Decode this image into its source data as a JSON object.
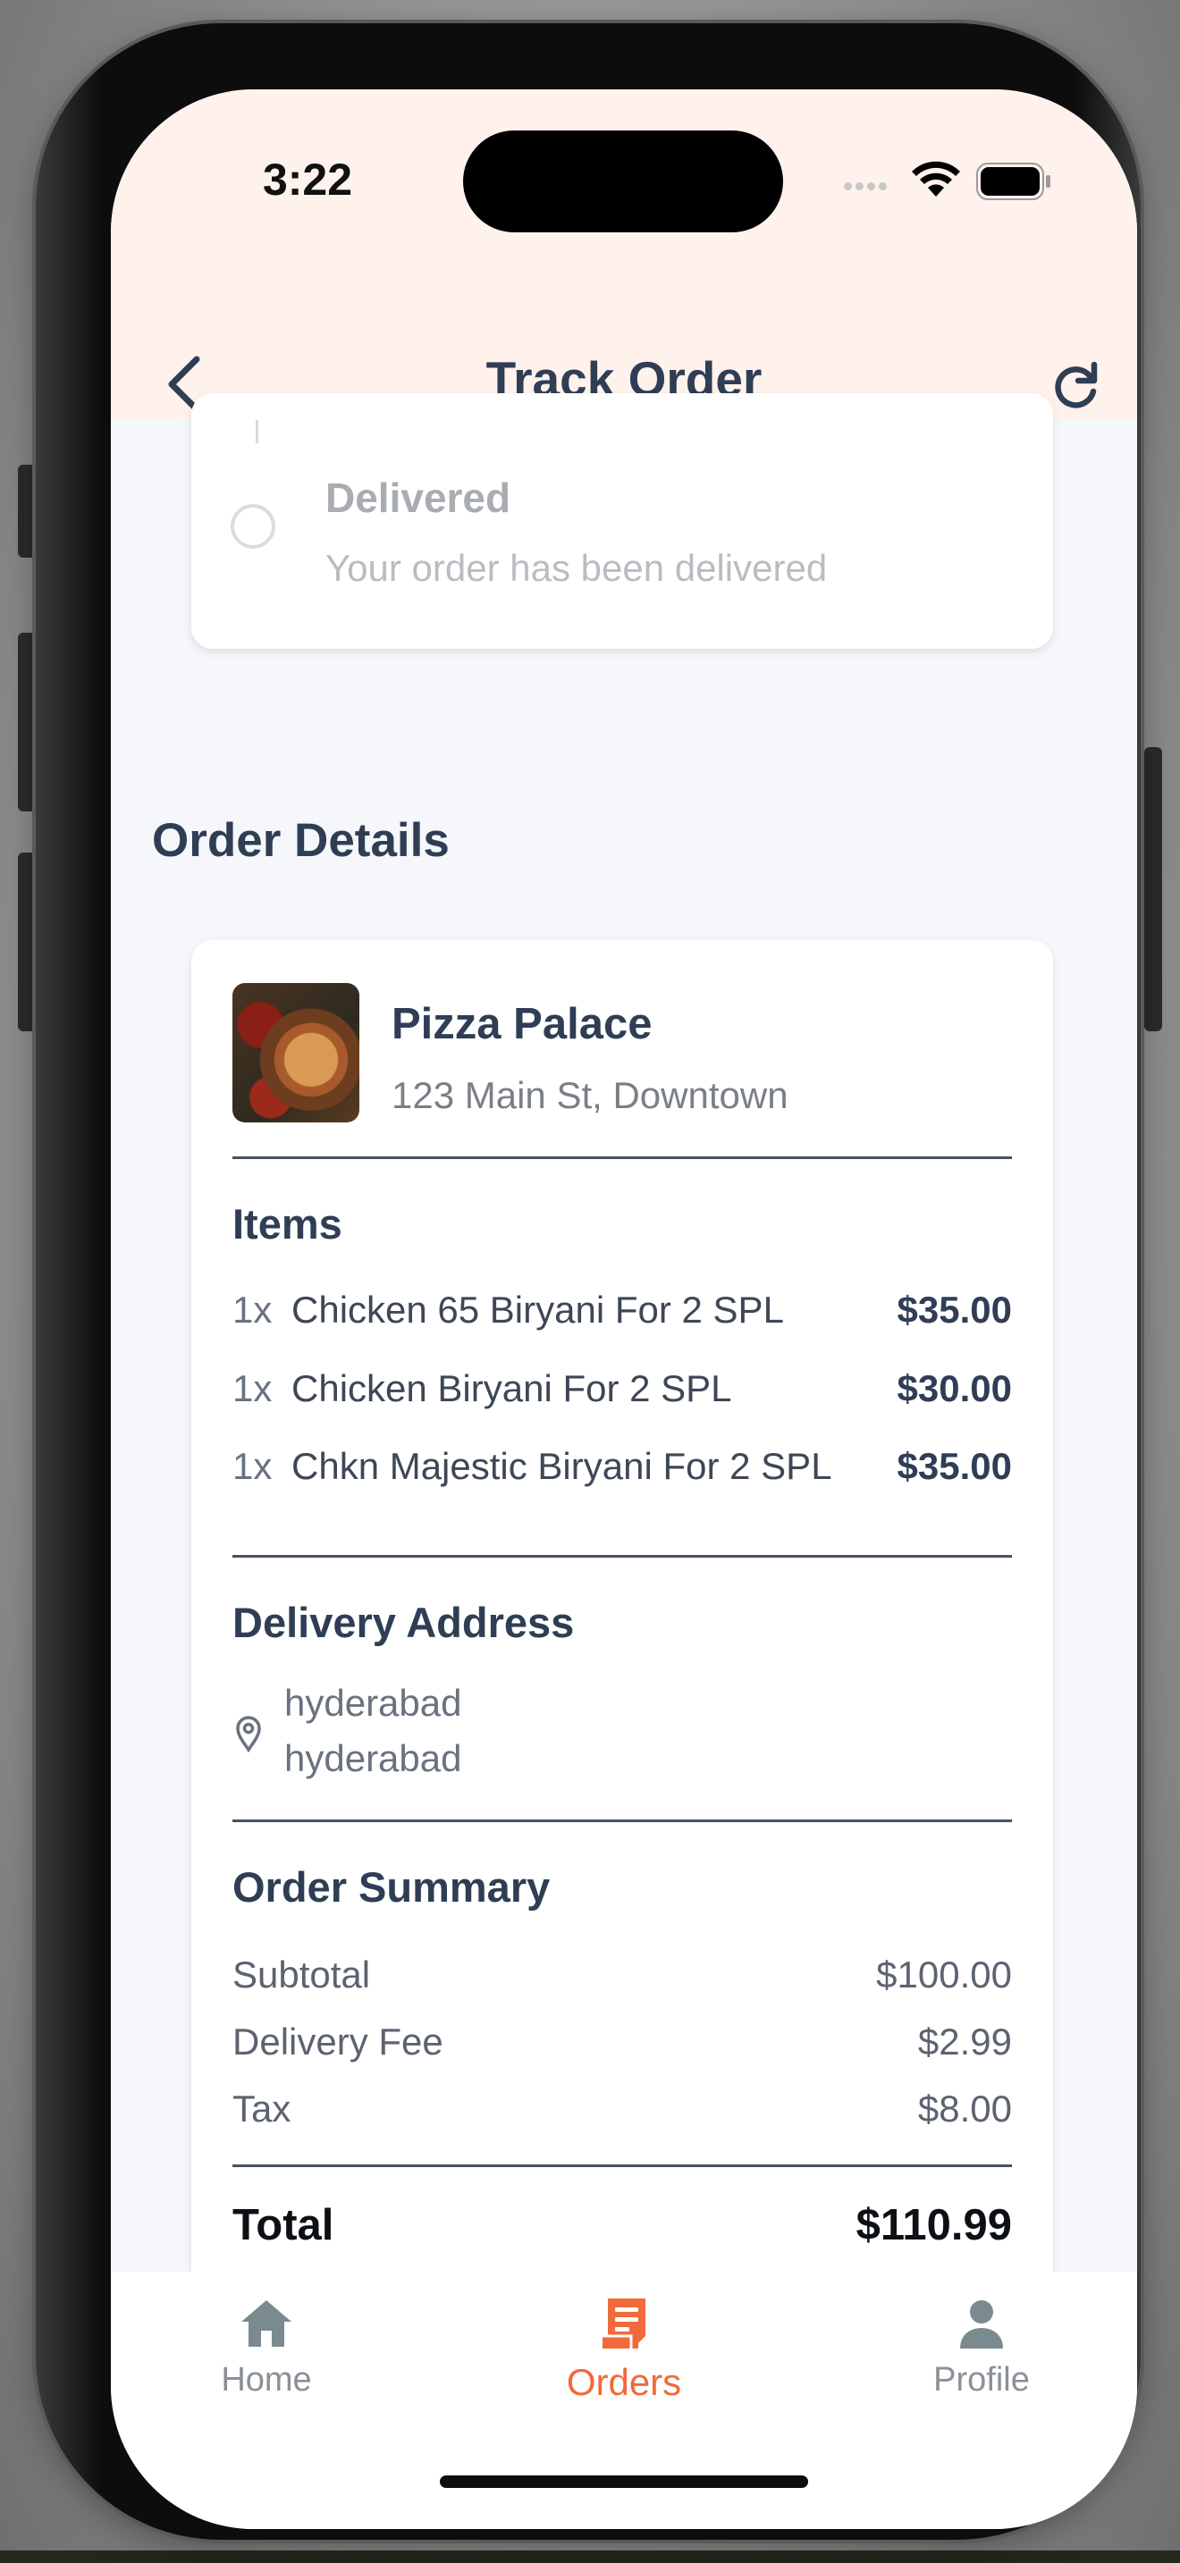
{
  "status_bar": {
    "time": "3:22"
  },
  "header": {
    "title": "Track Order"
  },
  "timeline": {
    "step": {
      "title": "Delivered",
      "description": "Your order has been delivered"
    }
  },
  "order_details": {
    "section_title": "Order Details",
    "restaurant": {
      "name": "Pizza Palace",
      "address": "123 Main St, Downtown"
    },
    "items_title": "Items",
    "items": [
      {
        "qty": "1x",
        "name": "Chicken 65 Biryani For 2 SPL",
        "price": "$35.00"
      },
      {
        "qty": "1x",
        "name": "Chicken Biryani For 2 SPL",
        "price": "$30.00"
      },
      {
        "qty": "1x",
        "name": "Chkn Majestic Biryani For 2 SPL",
        "price": "$35.00"
      }
    ],
    "delivery_title": "Delivery Address",
    "address_lines": [
      "hyderabad",
      "hyderabad"
    ],
    "summary_title": "Order Summary",
    "summary": {
      "subtotal_label": "Subtotal",
      "subtotal": "$100.00",
      "fee_label": "Delivery Fee",
      "fee": "$2.99",
      "tax_label": "Tax",
      "tax": "$8.00",
      "total_label": "Total",
      "total": "$110.99"
    }
  },
  "bottom_nav": {
    "items": [
      {
        "label": "Home",
        "icon": "home-icon",
        "active": false
      },
      {
        "label": "Orders",
        "icon": "receipt-icon",
        "active": true
      },
      {
        "label": "Profile",
        "icon": "person-icon",
        "active": false
      }
    ]
  },
  "colors": {
    "accent": "#f06a3b",
    "header_bg": "#fff2ec",
    "text_primary": "#2f3e55",
    "page_bg": "#f5f7fa"
  }
}
